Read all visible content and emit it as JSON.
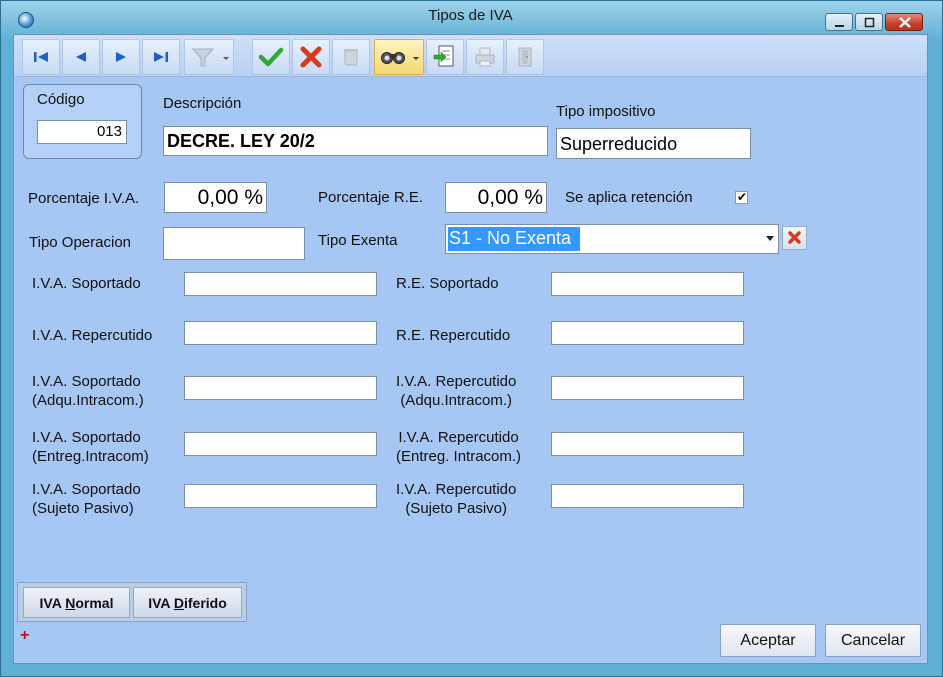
{
  "window": {
    "title": "Tipos de IVA"
  },
  "form": {
    "codigo_label": "Código",
    "codigo_value": "013",
    "descripcion_label": "Descripción",
    "descripcion_value": "DECRE. LEY 20/2",
    "tipo_impositivo_label": "Tipo impositivo",
    "tipo_impositivo_value": "Superreducido",
    "porcentaje_iva_label": "Porcentaje I.V.A.",
    "porcentaje_iva_value": "0,00 %",
    "porcentaje_re_label": "Porcentaje R.E.",
    "porcentaje_re_value": "0,00 %",
    "retencion_label": "Se aplica retención",
    "retencion_checked": true,
    "retencion_mark": "✔",
    "tipo_operacion_label": "Tipo Operacion",
    "tipo_operacion_value": "",
    "tipo_exenta_label": "Tipo Exenta",
    "tipo_exenta_value": "S1 - No Exenta",
    "iva_soportado_label": "I.V.A. Soportado",
    "re_soportado_label": "R.E. Soportado",
    "iva_repercutido_label": "I.V.A. Repercutido",
    "re_repercutido_label": "R.E. Repercutido",
    "iva_sop_adq_label_1": "I.V.A. Soportado",
    "iva_sop_adq_label_2": "(Adqu.Intracom.)",
    "iva_rep_adq_label_1": "I.V.A. Repercutido",
    "iva_rep_adq_label_2": "(Adqu.Intracom.)",
    "iva_sop_ent_label_1": "I.V.A. Soportado",
    "iva_sop_ent_label_2": "(Entreg.Intracom)",
    "iva_rep_ent_label_1": "I.V.A. Repercutido",
    "iva_rep_ent_label_2": "(Entreg. Intracom.)",
    "iva_sop_suj_label_1": "I.V.A. Soportado",
    "iva_sop_suj_label_2": "(Sujeto Pasivo)",
    "iva_rep_suj_label_1": "I.V.A. Repercutido",
    "iva_rep_suj_label_2": "(Sujeto Pasivo)"
  },
  "tabs": {
    "normal_pre": "IVA ",
    "normal_key": "N",
    "normal_post": "ormal",
    "diferido_pre": "IVA ",
    "diferido_key": "D",
    "diferido_post": "iferido"
  },
  "buttons": {
    "aceptar": "Aceptar",
    "cancelar": "Cancelar"
  },
  "status": {
    "expand_mark": "+"
  },
  "colors": {
    "client_bg": "#a6c6f4",
    "selection": "#3399ff",
    "accept_green": "#2eaa2e",
    "cancel_red": "#d93a1a"
  }
}
